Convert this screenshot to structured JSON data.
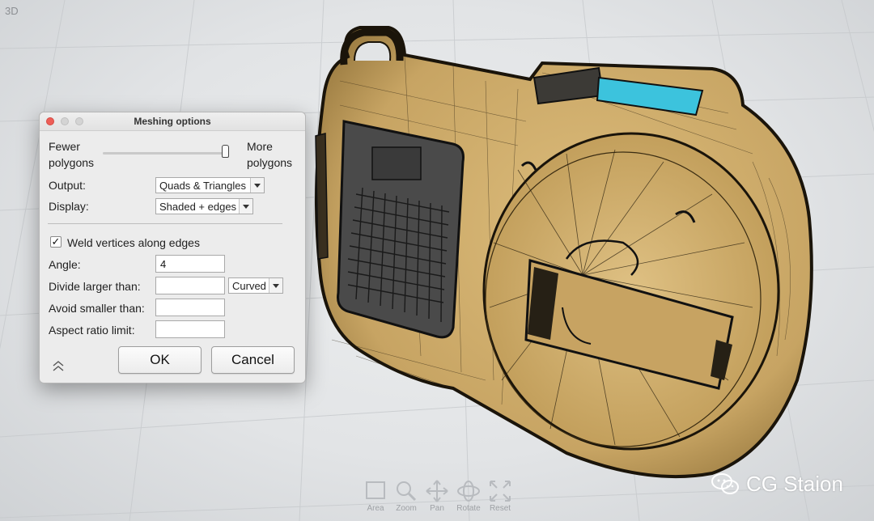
{
  "viewport": {
    "label": "3D"
  },
  "dialog": {
    "title": "Meshing options",
    "slider": {
      "left_label": "Fewer\npolygons",
      "right_label": "More\npolygons",
      "value": 0.95
    },
    "output": {
      "label": "Output:",
      "value": "Quads & Triangles"
    },
    "display": {
      "label": "Display:",
      "value": "Shaded + edges"
    },
    "weld": {
      "label": "Weld vertices along edges",
      "checked": true
    },
    "angle": {
      "label": "Angle:",
      "value": "4"
    },
    "divide": {
      "label": "Divide larger than:",
      "value": "",
      "mode": "Curved"
    },
    "avoid": {
      "label": "Avoid smaller than:",
      "value": ""
    },
    "aspect": {
      "label": "Aspect ratio limit:",
      "value": ""
    },
    "ok_label": "OK",
    "cancel_label": "Cancel"
  },
  "nav_tools": [
    {
      "label": "Area",
      "icon": "area-select-icon"
    },
    {
      "label": "Zoom",
      "icon": "zoom-icon"
    },
    {
      "label": "Pan",
      "icon": "pan-icon"
    },
    {
      "label": "Rotate",
      "icon": "rotate-icon"
    },
    {
      "label": "Reset",
      "icon": "reset-icon"
    }
  ],
  "watermark": {
    "text": "CG Staion"
  },
  "colors": {
    "model_body": "#cfae6e",
    "model_edges": "#1a140a",
    "display_screen": "#3cc3dd",
    "close_button": "#ee5e57"
  }
}
